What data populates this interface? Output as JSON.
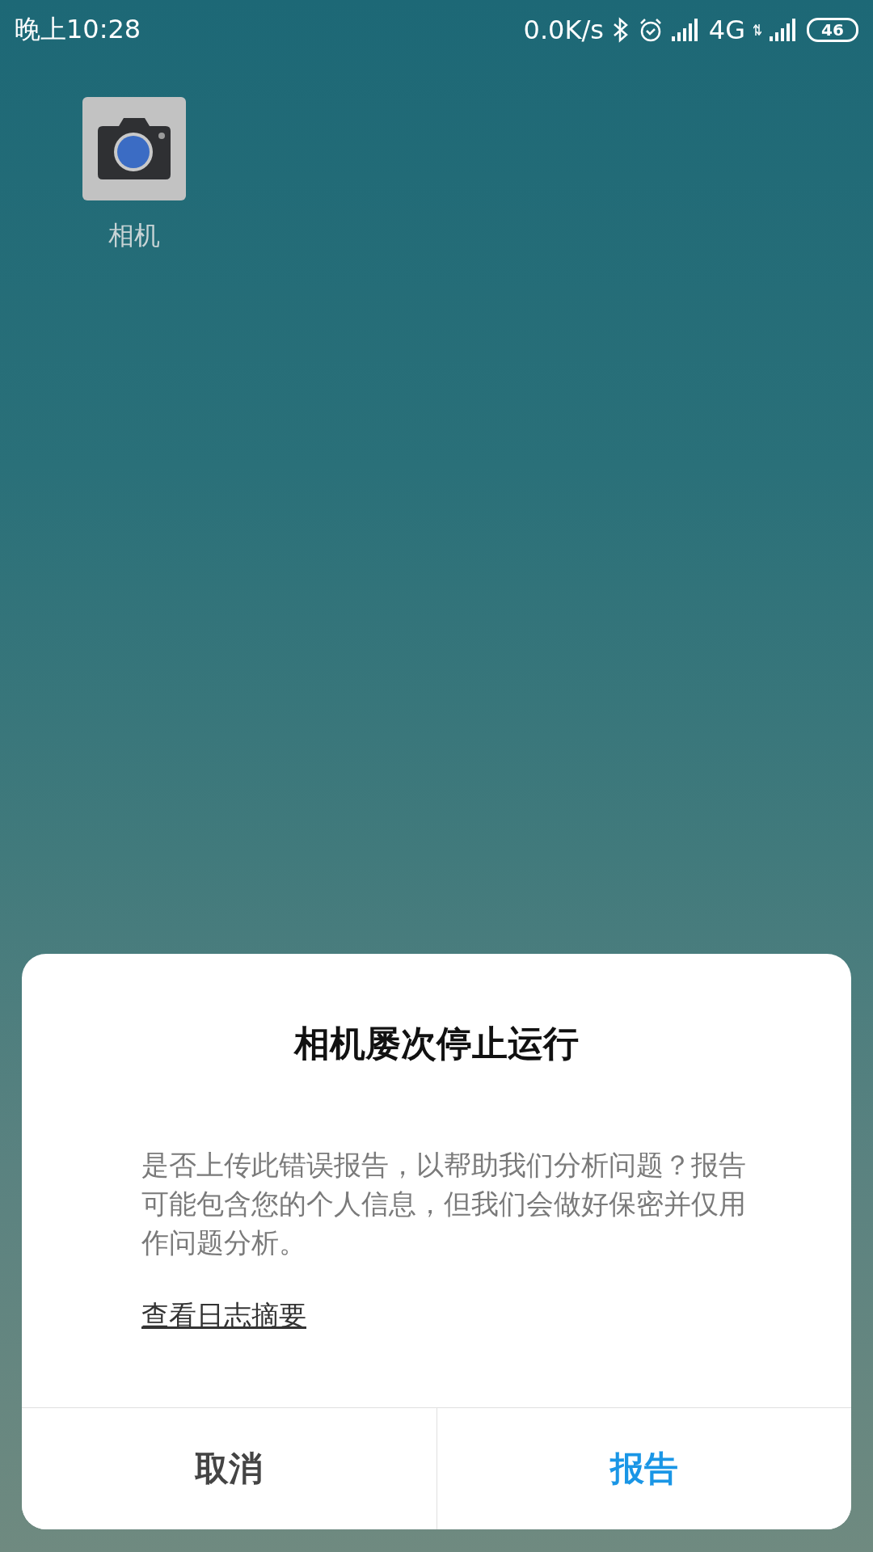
{
  "status_bar": {
    "time": "晚上10:28",
    "net_speed": "0.0K/s",
    "network_type": "4G",
    "battery": "46"
  },
  "home_apps": [
    {
      "label": "相机"
    }
  ],
  "dialog": {
    "title": "相机屡次停止运行",
    "message": "是否上传此错误报告，以帮助我们分析问题？报告可能包含您的个人信息，但我们会做好保密并仅用作问题分析。",
    "link": "查看日志摘要",
    "buttons": [
      {
        "label": "取消",
        "primary": false
      },
      {
        "label": "报告",
        "primary": true
      }
    ]
  }
}
